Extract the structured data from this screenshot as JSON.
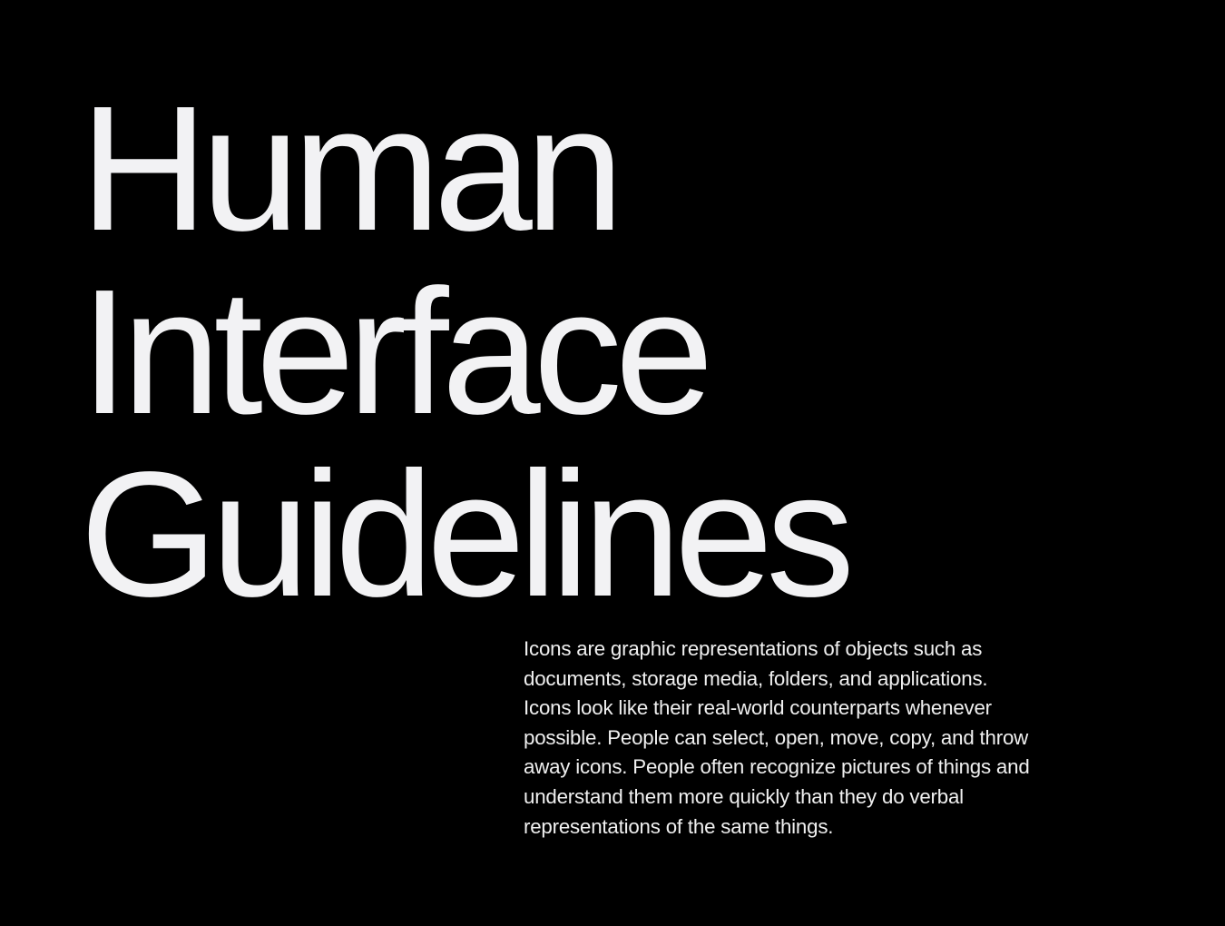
{
  "title": {
    "lines": [
      "Human",
      "Interface",
      "Guidelines"
    ]
  },
  "body": {
    "lines": [
      "Icons are graphic representations of objects such as",
      "documents, storage media, folders, and applications.",
      "Icons look like their real-world counterparts whenever",
      "possible. People can select, open, move, copy, and throw",
      "away icons. People often recognize pictures of things and",
      "understand them more quickly than they do verbal",
      "representations of the same things."
    ]
  },
  "colors": {
    "background": "#000000",
    "text": "#f2f2f4"
  }
}
